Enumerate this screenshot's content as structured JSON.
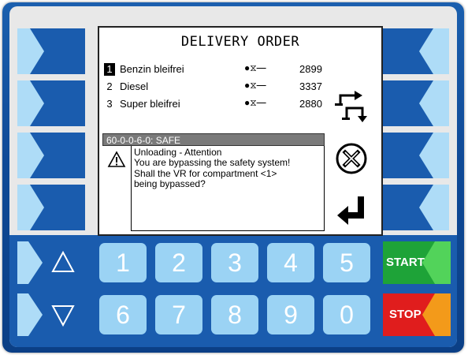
{
  "screen": {
    "title": "DELIVERY ORDER",
    "products": [
      {
        "num": "1",
        "name": "Benzin bleifrei",
        "symbol": "●⧖━",
        "value": "2899",
        "selected": true
      },
      {
        "num": "2",
        "name": "Diesel",
        "symbol": "●⧖━",
        "value": "3337",
        "selected": false
      },
      {
        "num": "3",
        "name": "Super bleifrei",
        "symbol": "●⧖━",
        "value": "2880",
        "selected": false
      }
    ],
    "message": {
      "header": "60-0-0-6-0: SAFE",
      "lines": [
        "Unloading - Attention",
        "You are bypassing the safety system!",
        "Shall the VR for compartment <1>",
        "being bypassed?"
      ]
    }
  },
  "icons": {
    "switch": "switch-arrows-icon",
    "cancel": "cancel-circle-x-icon",
    "enter": "enter-return-icon",
    "warning": "warning-triangle-icon",
    "up": "triangle-up-icon",
    "down": "triangle-down-icon"
  },
  "keypad": {
    "row1": [
      "1",
      "2",
      "3",
      "4",
      "5"
    ],
    "row2": [
      "6",
      "7",
      "8",
      "9",
      "0"
    ]
  },
  "controls": {
    "start_label": "START",
    "stop_label": "STOP"
  },
  "colors": {
    "frame": "#1a5cae",
    "key": "#9bd3f4",
    "start_green": "#1ea338",
    "start_light_green": "#52d35a",
    "stop_red": "#e01d1d",
    "stop_orange": "#f39a1a"
  }
}
